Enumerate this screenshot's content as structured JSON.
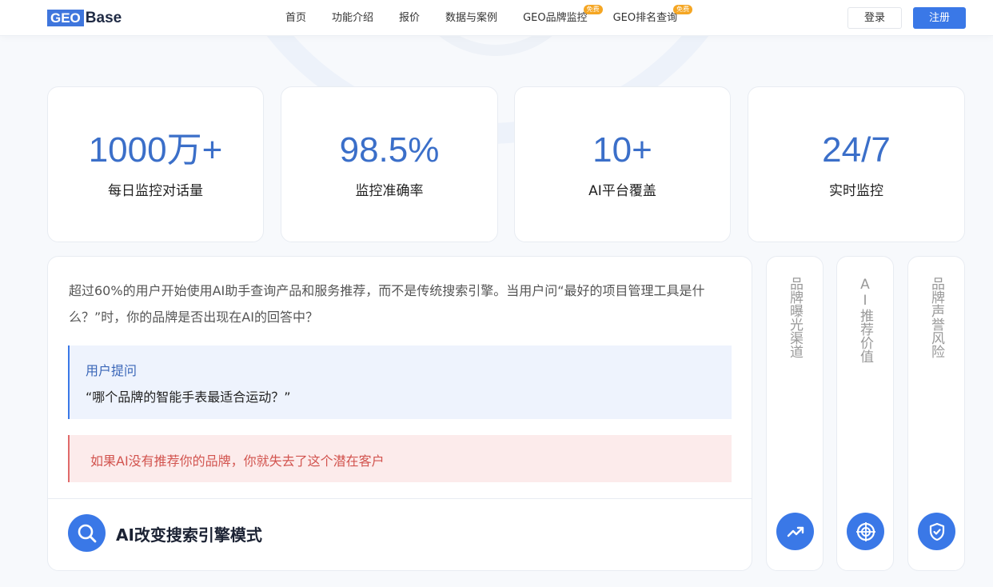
{
  "logo": {
    "part1": "GEO",
    "part2": "Base"
  },
  "nav": {
    "items": [
      {
        "label": "首页"
      },
      {
        "label": "功能介绍"
      },
      {
        "label": "报价"
      },
      {
        "label": "数据与案例"
      },
      {
        "label": "GEO品牌监控",
        "badge": "免费"
      },
      {
        "label": "GEO排名查询",
        "badge": "免费"
      }
    ],
    "login": "登录",
    "register": "注册"
  },
  "stats": [
    {
      "value": "1000万+",
      "label": "每日监控对话量"
    },
    {
      "value": "98.5%",
      "label": "监控准确率"
    },
    {
      "value": "10+",
      "label": "AI平台覆盖"
    },
    {
      "value": "24/7",
      "label": "实时监控"
    }
  ],
  "main": {
    "intro": "超过60%的用户开始使用AI助手查询产品和服务推荐，而不是传统搜索引擎。当用户问“最好的项目管理工具是什么？”时，你的品牌是否出现在AI的回答中？",
    "quote_label": "用户提问",
    "quote_text": "“哪个品牌的智能手表最适合运动？”",
    "warning": "如果AI没有推荐你的品牌，你就失去了这个潜在客户",
    "feature_title": "AI改变搜索引擎模式",
    "feature_icon": "search-icon"
  },
  "side_cards": [
    {
      "label": "品牌曝光渠道",
      "icon": "trending-up-icon"
    },
    {
      "label": "AI推荐价值",
      "icon": "target-icon"
    },
    {
      "label": "品牌声誉风险",
      "icon": "shield-check-icon"
    }
  ],
  "colors": {
    "accent": "#3a78e7",
    "stat_value": "#3b6fc9",
    "warning": "#d2544f",
    "badge": "#f5a623"
  }
}
